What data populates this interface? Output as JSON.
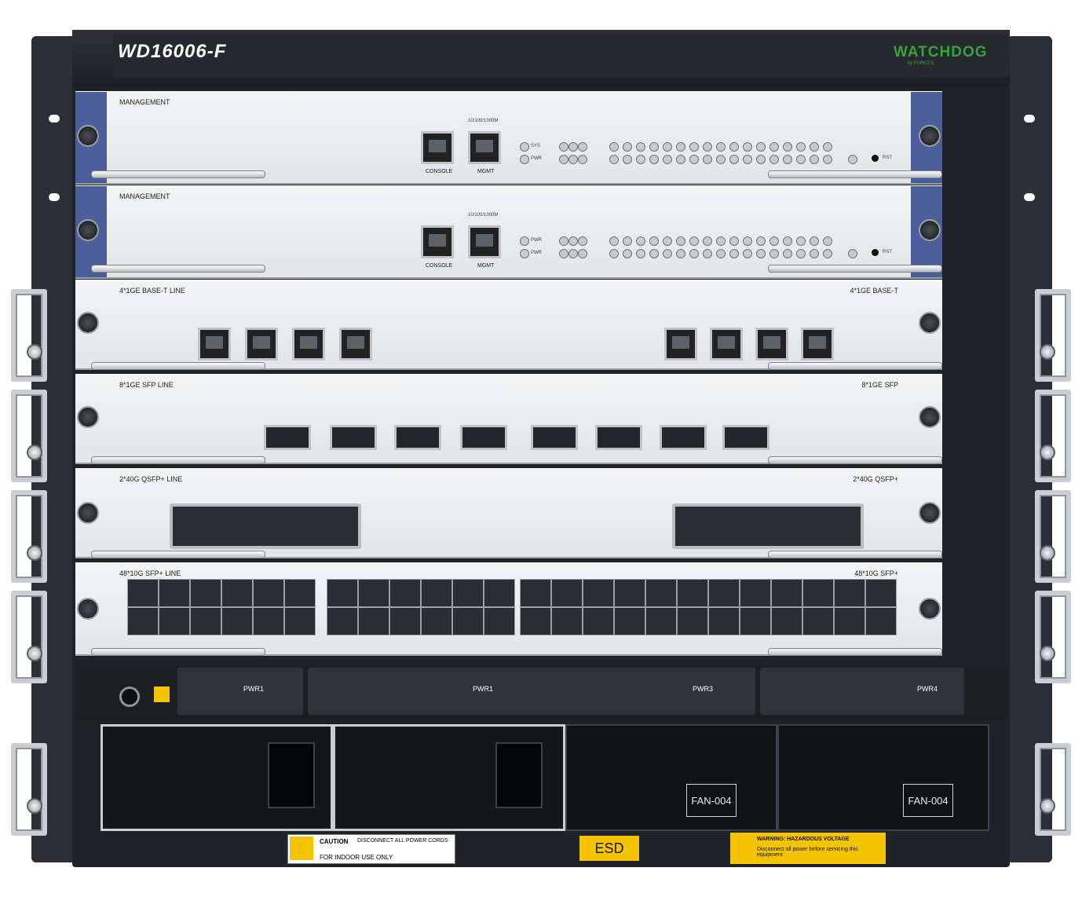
{
  "device": {
    "model": "WD16006-F",
    "brand": "WATCHDOG",
    "brand_sub": "by FORCES"
  },
  "mpu1": {
    "label": "MANAGEMENT",
    "console": "CONSOLE",
    "mgmt": "MGMT",
    "speed": "10/100/1000M",
    "led_sys": "SYS",
    "led_pwr": "PWR",
    "rst": "RST"
  },
  "mpu2": {
    "label": "MANAGEMENT",
    "console": "CONSOLE",
    "mgmt": "MGMT",
    "speed": "10/100/1000M",
    "led_sys": "PWR",
    "led_pwr": "PWR",
    "rst": "RST"
  },
  "card3": {
    "label": "4*1GE BASE-T LINE",
    "label_r": "4*1GE BASE-T"
  },
  "card4": {
    "label": "8*1GE SFP LINE",
    "label_r": "8*1GE SFP"
  },
  "card5": {
    "label": "2*40G QSFP+ LINE",
    "label_r": "2*40G QSFP+"
  },
  "card6": {
    "label": "48*10G SFP+ LINE",
    "label_r": "48*10G SFP+"
  },
  "power": [
    "PWR1",
    "PWR1",
    "PWR3",
    "PWR4"
  ],
  "fans": [
    "FAN-004",
    "FAN-004"
  ],
  "warnings": {
    "caution_title": "CAUTION",
    "caution_text": "DISCONNECT ALL POWER CORDS",
    "caution_text2": "FOR INDOOR USE ONLY",
    "esd": "ESD",
    "warning_title": "WARNING: HAZARDOUS VOLTAGE",
    "warning_text": "Disconnect all power before servicing this equipment"
  }
}
